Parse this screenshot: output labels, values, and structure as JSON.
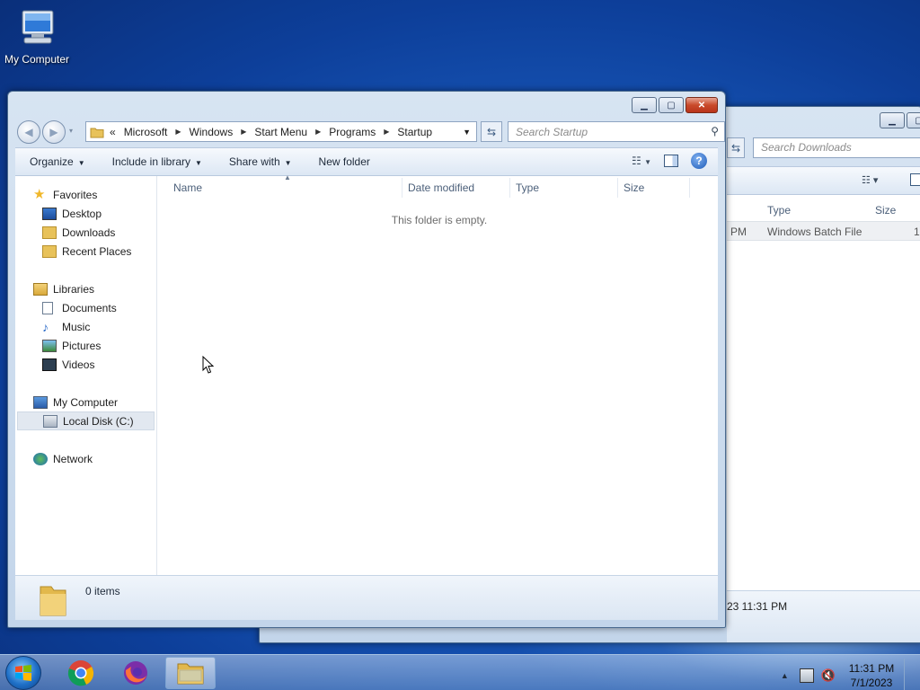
{
  "desktop": {
    "icons": [
      {
        "label": "My Computer"
      }
    ]
  },
  "background_window": {
    "search_placeholder": "Search Downloads",
    "columns": {
      "type": "Type",
      "size": "Size"
    },
    "row": {
      "modified_tail": "PM",
      "type": "Windows Batch File",
      "size_fragment": "1"
    },
    "details_text": "23 11:31 PM"
  },
  "main_window": {
    "address": {
      "overflow": "«",
      "crumbs": [
        "Microsoft",
        "Windows",
        "Start Menu",
        "Programs",
        "Startup"
      ]
    },
    "search_placeholder": "Search Startup",
    "toolbar": {
      "organize": "Organize",
      "include_in_library": "Include in library",
      "share_with": "Share with",
      "new_folder": "New folder"
    },
    "nav": {
      "favorites": "Favorites",
      "desktop": "Desktop",
      "downloads": "Downloads",
      "recent_places": "Recent Places",
      "libraries": "Libraries",
      "documents": "Documents",
      "music": "Music",
      "pictures": "Pictures",
      "videos": "Videos",
      "my_computer": "My Computer",
      "local_disk": "Local Disk (C:)",
      "network": "Network"
    },
    "columns": {
      "name": "Name",
      "date_modified": "Date modified",
      "type": "Type",
      "size": "Size"
    },
    "empty_message": "This folder is empty.",
    "details": {
      "item_count": "0 items"
    }
  },
  "taskbar": {
    "pinned": [
      "chrome-icon",
      "firefox-icon",
      "explorer-icon"
    ],
    "clock": {
      "time": "11:31 PM",
      "date": "7/1/2023"
    }
  }
}
